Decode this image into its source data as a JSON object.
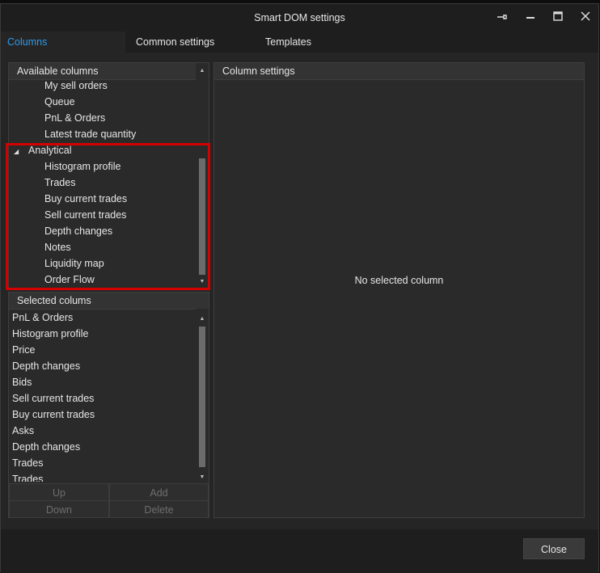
{
  "window": {
    "title": "Smart DOM settings",
    "controls": [
      "pin-icon",
      "minimize-icon",
      "maximize-icon",
      "close-icon"
    ]
  },
  "tabs": [
    {
      "label": "Columns",
      "active": true
    },
    {
      "label": "Common settings",
      "active": false
    },
    {
      "label": "Templates",
      "active": false
    }
  ],
  "available": {
    "header": "Available columns",
    "items": [
      {
        "label": "My sell orders",
        "group": false
      },
      {
        "label": "Queue",
        "group": false
      },
      {
        "label": "PnL & Orders",
        "group": false
      },
      {
        "label": "Latest trade quantity",
        "group": false
      },
      {
        "label": "Analytical",
        "group": true
      },
      {
        "label": "Histogram profile",
        "group": false
      },
      {
        "label": "Trades",
        "group": false
      },
      {
        "label": "Buy current trades",
        "group": false
      },
      {
        "label": "Sell current trades",
        "group": false
      },
      {
        "label": "Depth changes",
        "group": false
      },
      {
        "label": "Notes",
        "group": false
      },
      {
        "label": "Liquidity map",
        "group": false
      },
      {
        "label": "Order Flow",
        "group": false
      }
    ]
  },
  "selected": {
    "header": "Selected colums",
    "items": [
      "PnL & Orders",
      "Histogram profile",
      "Price",
      "Depth changes",
      "Bids",
      "Sell current trades",
      "Buy current trades",
      "Asks",
      "Depth changes",
      "Trades",
      "Trades"
    ]
  },
  "buttons": {
    "up": "Up",
    "add": "Add",
    "down": "Down",
    "delete": "Delete"
  },
  "column_settings": {
    "header": "Column settings",
    "empty_message": "No selected column"
  },
  "footer": {
    "close": "Close"
  },
  "colors": {
    "accent": "#2b9be8",
    "highlight": "#d40000",
    "background": "#252526"
  }
}
